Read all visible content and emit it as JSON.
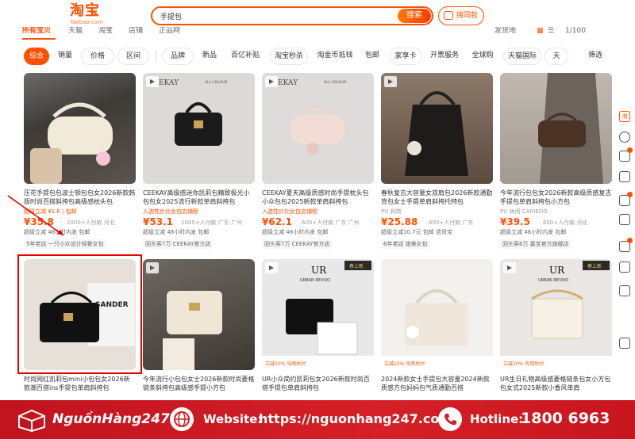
{
  "header": {
    "logo": "淘宝",
    "logo_sub": "Taobao.com",
    "search_query": "手提包",
    "search_button": "搜索",
    "image_search": "搜同款"
  },
  "tabs": [
    "所有宝贝",
    "天猫",
    "淘宝",
    "店铺",
    "正品网"
  ],
  "tabs_right": {
    "delivery": "发货地",
    "page": "1/100"
  },
  "filters": [
    "综合",
    "销量",
    "价格",
    "区间",
    "品牌",
    "新品",
    "百亿补贴",
    "淘宝秒杀",
    "淘金币抵钱",
    "包邮",
    "家享卡",
    "开票服务",
    "全球购",
    "天猫国际",
    "天",
    "筛选"
  ],
  "products": [
    {
      "title": "压花手提包包波士顿包包女2026新款韩版时尚百搭斜挎包高级感枕头包",
      "tag": "超级立减 ¥1.6 | 包邮",
      "price": "¥35.8",
      "meta": "2000+人付款 河北",
      "sub": "超级立减 48小时内发 包邮",
      "shop": "5年老店 一只小众设计轻奢女包"
    },
    {
      "title": "CEEKAY高级感迷你凯莉包精致极光小包包女2025流行新款单肩斜挎包",
      "tag": "入选性价比女包店铺榜",
      "price": "¥53.1",
      "meta": "1000+人付款 广东 广州",
      "sub": "超级立减 48小时内发 包邮",
      "shop": "回头客7万 CEEKAY官方店"
    },
    {
      "title": "CEEKAY夏天高级质感时尚手提枕头包小众包包2025新款单肩斜挎包",
      "tag": "入选性价比女包店铺榜",
      "price": "¥62.1",
      "meta": "600+人付款 广东 广州",
      "sub": "超级立减 48小时内发 包邮",
      "shop": "回头客7万 CEEKAY官方店"
    },
    {
      "title": "春秋复古大容量女双肩包2026新款通勤背包女士手提单肩斜挎托特包",
      "tag": "PU 斜挎",
      "price": "¥25.88",
      "meta": "800+人付款 广东",
      "sub": "超级立减10.7元 包邮 退货宝",
      "shop": "6年老店 旅美女包"
    },
    {
      "title": "今年流行包包女2026新款高级质感复古手提包单肩斜挎包小方包",
      "tag": "PU 休闲 CARIEDO",
      "price": "¥39.5",
      "meta": "600+人付款 河北",
      "sub": "超级立减 48小时内发 包邮",
      "shop": "回头客6万 嘉宝官方旗舰店"
    },
    {
      "title": "时尚网红凯莉包mini小包包女2026新款潮百搭ins手提包单肩斜挎包",
      "tag": "",
      "price": "",
      "meta": "",
      "sub": "",
      "shop": ""
    },
    {
      "title": "今年流行小包包女士2026新款时尚菱格链条斜挎包高级感手提小方包",
      "tag": "",
      "price": "",
      "meta": "",
      "sub": "",
      "shop": ""
    },
    {
      "title": "UR小众简约凯莉包女2026新款时尚百搭手提包单肩斜挎包",
      "tag": "立减10% 先用后付",
      "price": "",
      "meta": "",
      "sub": "",
      "shop": ""
    },
    {
      "title": "2024新款女士手提包大容量2024新款质感方包妈妈包气质通勤百搭",
      "tag": "立减10% 先用后付",
      "price": "",
      "meta": "",
      "sub": "",
      "shop": ""
    },
    {
      "title": "UR生日礼物高级感菱格链条包女小方包包女式2025新款小香风单肩",
      "tag": "立减10% 先用后付",
      "price": "",
      "meta": "",
      "sub": "",
      "shop": ""
    }
  ],
  "image_labels": {
    "ceekay": "CEEKAY",
    "all_colour": "ALL COLOUR",
    "ur": "UR",
    "urban": "URBAN REVIVO",
    "new": "春上新",
    "sander": "SANDER"
  },
  "footer": {
    "brand": "NguồnHàng247",
    "website_label": "Website:",
    "website": "https://nguonhang247.com/",
    "hotline_label": "Hotline:",
    "hotline": "1800 6963"
  },
  "colors": {
    "accent": "#ff5000",
    "footer_red": "#d61f26",
    "annotation": "#e00000"
  }
}
